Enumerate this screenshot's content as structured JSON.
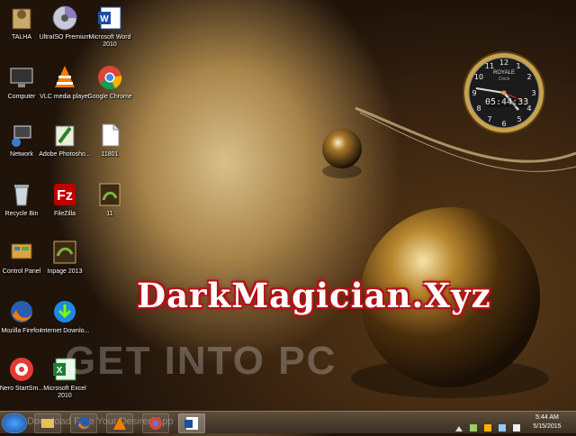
{
  "desktop_icons": [
    {
      "label": "TALHA",
      "icon": "user-folder-icon"
    },
    {
      "label": "UltraISO Premium",
      "icon": "disc-icon"
    },
    {
      "label": "Microsoft Word 2010",
      "icon": "word-icon"
    },
    {
      "label": "Computer",
      "icon": "computer-icon"
    },
    {
      "label": "VLC media player",
      "icon": "vlc-icon"
    },
    {
      "label": "Google Chrome",
      "icon": "chrome-icon"
    },
    {
      "label": "Network",
      "icon": "network-icon"
    },
    {
      "label": "Adobe Photosho...",
      "icon": "photoshop-icon"
    },
    {
      "label": "11801",
      "icon": "document-icon"
    },
    {
      "label": "Recycle Bin",
      "icon": "recycle-bin-icon"
    },
    {
      "label": "FileZilla",
      "icon": "filezilla-icon"
    },
    {
      "label": "11",
      "icon": "image-icon"
    },
    {
      "label": "Control Panel",
      "icon": "control-panel-icon"
    },
    {
      "label": "Inpage 2013",
      "icon": "inpage-icon"
    },
    {
      "label": "Mozilla Firefox",
      "icon": "firefox-icon"
    },
    {
      "label": "Internet Downlo...",
      "icon": "idm-icon"
    },
    {
      "label": "Nero StartSm...",
      "icon": "nero-icon"
    },
    {
      "label": "Microsoft Excel 2010",
      "icon": "excel-icon"
    }
  ],
  "clock_gadget": {
    "brand": "ROYALE",
    "sub": "Clock",
    "digital_time": "05:44:33"
  },
  "watermarks": {
    "main": "DarkMagician.Xyz",
    "secondary": "GET INTO PC",
    "taskbar": "Download Free Your Desired App"
  },
  "taskbar": {
    "pinned": [
      "start-orb-icon",
      "explorer-icon",
      "firefox-icon",
      "vlc-icon",
      "chrome-icon",
      "word-icon"
    ],
    "time": "5:44 AM",
    "date": "5/15/2015"
  },
  "colors": {
    "watermark_outline": "#b3121a",
    "taskbar": "#4a3c2d"
  }
}
